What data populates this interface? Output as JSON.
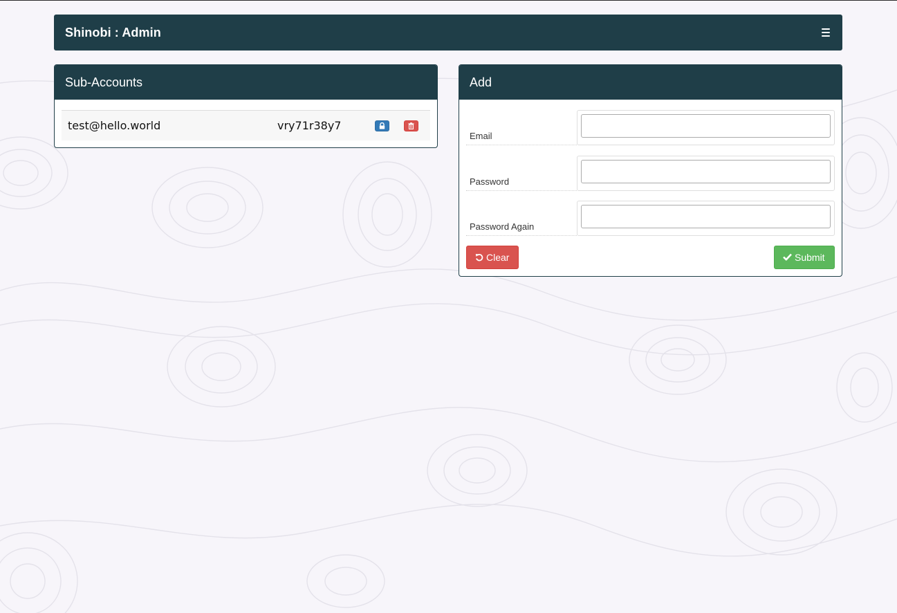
{
  "navbar": {
    "title": "Shinobi : Admin",
    "menu_icon": "hamburger-menu-icon",
    "bg_color": "#1f3e48"
  },
  "sub_accounts": {
    "title": "Sub-Accounts",
    "rows": [
      {
        "email": "test@hello.world",
        "password": "vry71r38y7",
        "lock_icon": "lock-icon",
        "delete_icon": "trash-icon"
      }
    ]
  },
  "add_form": {
    "title": "Add",
    "fields": [
      {
        "label": "Email",
        "value": "",
        "placeholder": ""
      },
      {
        "label": "Password",
        "value": "",
        "placeholder": ""
      },
      {
        "label": "Password Again",
        "value": "",
        "placeholder": ""
      }
    ],
    "clear_label": "Clear",
    "clear_icon": "undo-icon",
    "clear_color": "#d9534f",
    "submit_label": "Submit",
    "submit_icon": "check-icon",
    "submit_color": "#5cb85c"
  }
}
